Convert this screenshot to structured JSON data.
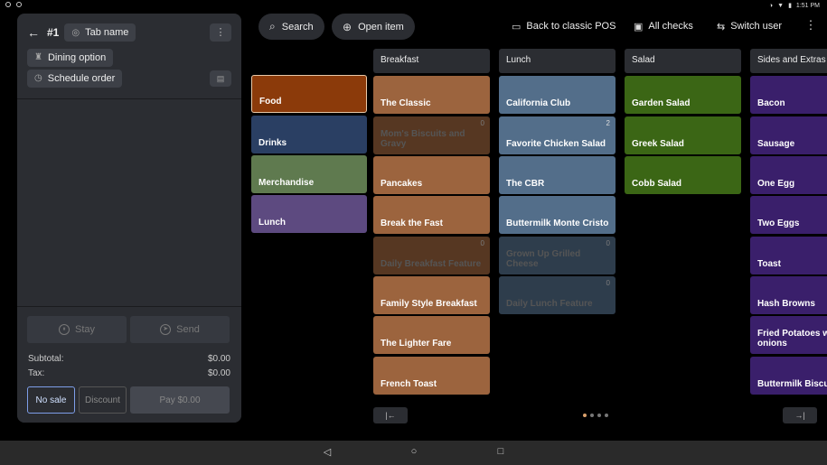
{
  "status_bar": {
    "time": "1:51 PM"
  },
  "order": {
    "back_icon": "back-arrow-icon",
    "number": "#1",
    "tab_name": "Tab name",
    "dining_option": "Dining option",
    "schedule_order": "Schedule order",
    "stay_label": "Stay",
    "send_label": "Send",
    "subtotal_label": "Subtotal:",
    "subtotal_value": "$0.00",
    "tax_label": "Tax:",
    "tax_value": "$0.00",
    "no_sale_label": "No sale",
    "discount_label": "Discount",
    "pay_label": "Pay $0.00"
  },
  "topbar": {
    "search_label": "Search",
    "open_item_label": "Open item",
    "back_classic_label": "Back to classic POS",
    "all_checks_label": "All checks",
    "switch_user_label": "Switch user"
  },
  "groups": {
    "items": [
      {
        "label": "Food",
        "color": "#8b3a0a",
        "selected": true
      },
      {
        "label": "Drinks",
        "color": "#2a3f63"
      },
      {
        "label": "Merchandise",
        "color": "#5f7a4f"
      },
      {
        "label": "Lunch",
        "color": "#5d4a80"
      }
    ]
  },
  "columns": [
    {
      "title": "Breakfast",
      "color": "#9c643e",
      "items": [
        {
          "label": "The Classic"
        },
        {
          "label": "Mom's Biscuits and Gravy",
          "count": "0",
          "dim": true
        },
        {
          "label": "Pancakes"
        },
        {
          "label": "Break the Fast"
        },
        {
          "label": "Daily Breakfast Feature",
          "count": "0",
          "dim": true
        },
        {
          "label": "Family Style Breakfast"
        },
        {
          "label": "The Lighter Fare"
        },
        {
          "label": "French Toast"
        }
      ]
    },
    {
      "title": "Lunch",
      "color": "#536e8a",
      "items": [
        {
          "label": "California Club"
        },
        {
          "label": "Favorite Chicken Salad",
          "count": "2"
        },
        {
          "label": "The CBR"
        },
        {
          "label": "Buttermilk Monte Cristo"
        },
        {
          "label": "Grown Up Grilled Cheese",
          "count": "0",
          "dim": true
        },
        {
          "label": "Daily Lunch Feature",
          "count": "0",
          "dim": true
        }
      ]
    },
    {
      "title": "Salad",
      "color": "#3b6615",
      "items": [
        {
          "label": "Garden Salad"
        },
        {
          "label": "Greek Salad"
        },
        {
          "label": "Cobb Salad"
        }
      ]
    },
    {
      "title": "Sides and Extras",
      "color": "#3a1f6b",
      "items": [
        {
          "label": "Bacon"
        },
        {
          "label": "Sausage"
        },
        {
          "label": "One Egg"
        },
        {
          "label": "Two Eggs"
        },
        {
          "label": "Toast"
        },
        {
          "label": "Hash Browns"
        },
        {
          "label": "Fried Potatoes w onions"
        },
        {
          "label": "Buttermilk Biscu"
        }
      ]
    }
  ],
  "pagination": {
    "prev_icon": "first-page-icon",
    "next_icon": "last-page-icon",
    "pages": 4,
    "current": 1
  }
}
